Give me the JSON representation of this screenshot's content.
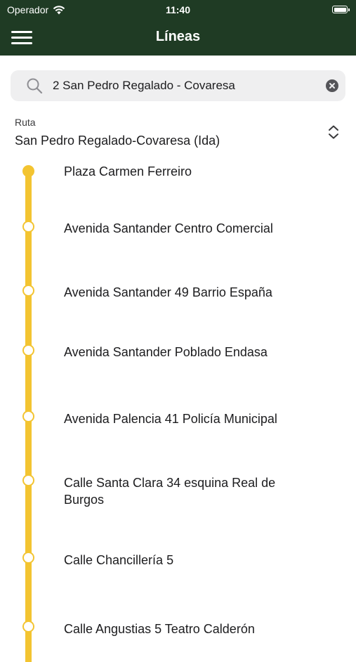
{
  "status_bar": {
    "carrier": "Operador",
    "time": "11:40",
    "wifi_icon": "wifi-icon",
    "battery_icon": "battery-icon"
  },
  "nav": {
    "title": "Líneas",
    "menu_icon": "hamburger-menu-icon"
  },
  "search": {
    "value": "2 San Pedro Regalado - Covaresa",
    "search_icon": "magnifier-icon",
    "clear_icon": "clear-circle-icon"
  },
  "route": {
    "label": "Ruta",
    "value": "San Pedro Regalado-Covaresa (Ida)",
    "chevron_icon": "chevron-up-down-icon"
  },
  "stops": [
    {
      "name": "Plaza Carmen Ferreiro",
      "active": true
    },
    {
      "name": "Avenida Santander Centro Comercial",
      "active": false
    },
    {
      "name": "Avenida Santander 49 Barrio España",
      "active": false
    },
    {
      "name": "Avenida Santander Poblado Endasa",
      "active": false
    },
    {
      "name": "Avenida Palencia 41 Policía Municipal",
      "active": false
    },
    {
      "name": "Calle Santa Clara 34 esquina Real de Burgos",
      "active": false
    },
    {
      "name": "Calle Chancillería 5",
      "active": false
    },
    {
      "name": "Calle Angustias 5 Teatro Calderón",
      "active": false
    }
  ],
  "colors": {
    "header_green": "#1f3b24",
    "line_yellow": "#f3c431",
    "search_bg": "#efeff0"
  }
}
